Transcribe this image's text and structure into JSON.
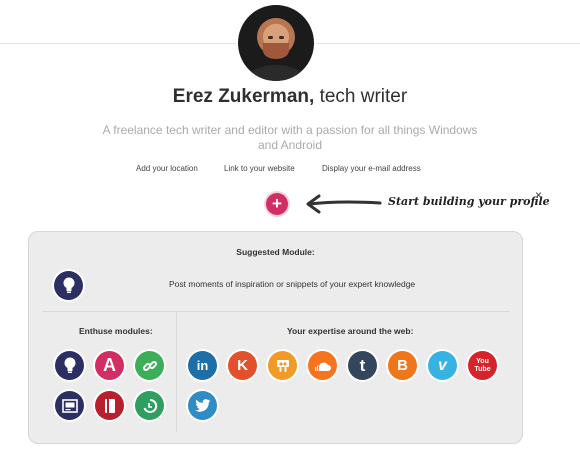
{
  "profile": {
    "name": "Erez Zukerman,",
    "role": "tech writer",
    "bio": "A freelance tech writer and editor with a passion for all things Windows and Android"
  },
  "profile_links": {
    "location": "Add your location",
    "website": "Link to your website",
    "email": "Display your e-mail address"
  },
  "builder": {
    "add_label": "+",
    "hint": "Start building your profile",
    "close_label": "×"
  },
  "panel": {
    "suggested_title": "Suggested Module:",
    "suggested_icon": "lightbulb-icon",
    "suggested_text": "Post moments of inspiration or snippets of your expert knowledge",
    "enthuse_title": "Enthuse modules:",
    "web_title": "Your expertise around the web:"
  },
  "enthuse_modules": [
    {
      "icon": "lightbulb-icon",
      "color": "#2b2f62"
    },
    {
      "icon": "letter-a-icon",
      "label": "A",
      "color": "#d22e63"
    },
    {
      "icon": "link-icon",
      "color": "#3cae59"
    },
    {
      "icon": "media-frame-icon",
      "color": "#2b2f62"
    },
    {
      "icon": "book-icon",
      "color": "#b8202d"
    },
    {
      "icon": "refresh-icon",
      "color": "#2e9e61"
    }
  ],
  "web_services": [
    {
      "icon": "linkedin-icon",
      "label": "in",
      "color": "#1e6ea7"
    },
    {
      "icon": "klout-icon",
      "label": "K",
      "color": "#e2502c"
    },
    {
      "icon": "slideshare-icon",
      "color": "#f19a26"
    },
    {
      "icon": "soundcloud-icon",
      "color": "#f7741c"
    },
    {
      "icon": "tumblr-icon",
      "label": "t",
      "color": "#34465d"
    },
    {
      "icon": "blogger-icon",
      "label": "B",
      "color": "#f0761c"
    },
    {
      "icon": "vimeo-icon",
      "label": "v",
      "color": "#37b3e3"
    },
    {
      "icon": "youtube-icon",
      "label": "You Tube",
      "color": "#d8232a"
    },
    {
      "icon": "twitter-icon",
      "color": "#2e8dc4"
    }
  ]
}
